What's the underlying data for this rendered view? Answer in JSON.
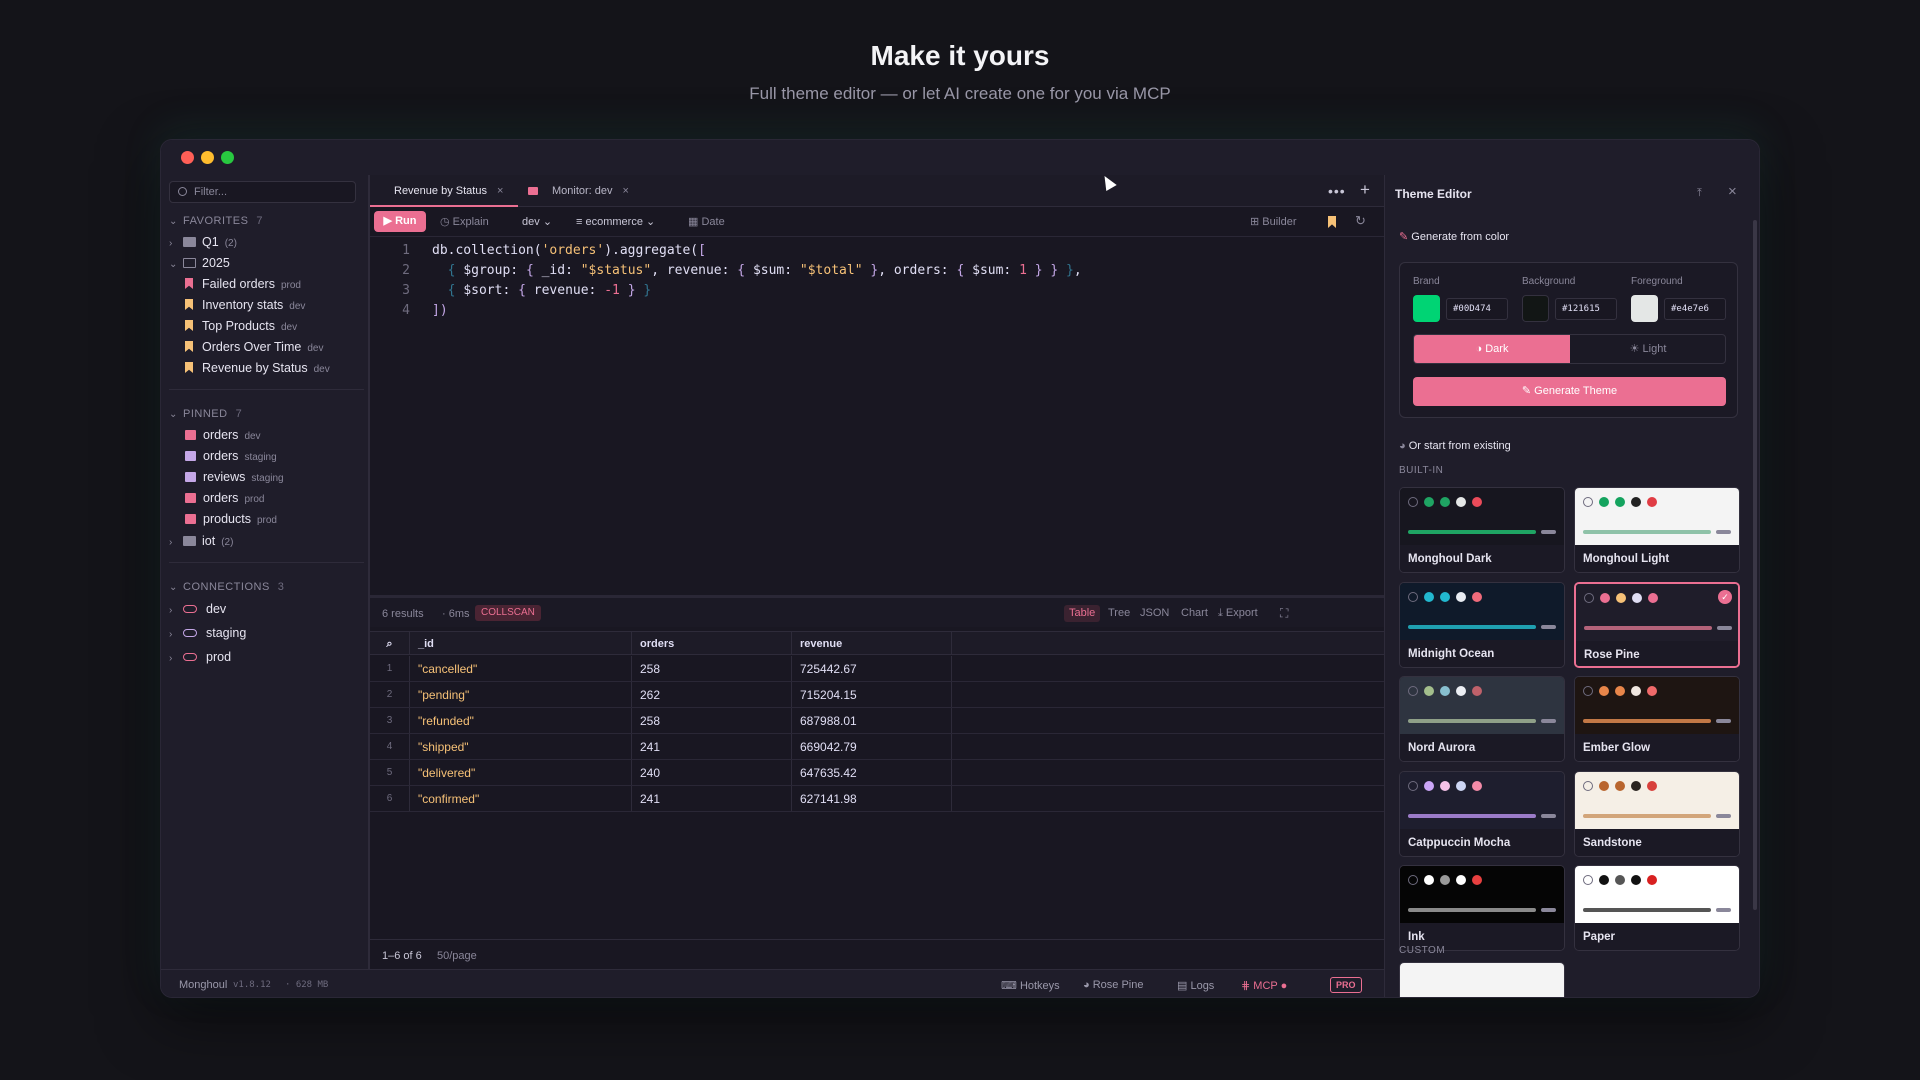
{
  "hero": {
    "title": "Make it yours",
    "subtitle": "Full theme editor — or let AI create one for you via MCP"
  },
  "window": {
    "traffic_lights": [
      "#ff5f57",
      "#febc2e",
      "#28c840"
    ]
  },
  "sidebar": {
    "filter_placeholder": "Filter...",
    "favorites": {
      "label": "FAVORITES",
      "count": "7",
      "folders": [
        {
          "name": "Q1",
          "count": "(2)"
        },
        {
          "name": "2025"
        }
      ],
      "items": [
        {
          "name": "Failed orders",
          "env": "prod",
          "color": "#eb6f92"
        },
        {
          "name": "Inventory stats",
          "env": "dev",
          "color": "#f6c177"
        },
        {
          "name": "Top Products",
          "env": "dev",
          "color": "#f6c177"
        },
        {
          "name": "Orders Over Time",
          "env": "dev",
          "color": "#f6c177"
        },
        {
          "name": "Revenue by Status",
          "env": "dev",
          "color": "#f6c177"
        }
      ]
    },
    "pinned": {
      "label": "PINNED",
      "count": "7",
      "items": [
        {
          "name": "orders",
          "env": "dev",
          "color": "#eb6f92"
        },
        {
          "name": "orders",
          "env": "staging",
          "color": "#c4a7e7"
        },
        {
          "name": "reviews",
          "env": "staging",
          "color": "#c4a7e7"
        },
        {
          "name": "orders",
          "env": "prod",
          "color": "#eb6f92"
        },
        {
          "name": "products",
          "env": "prod",
          "color": "#eb6f92"
        }
      ],
      "folder": {
        "name": "iot",
        "count": "(2)"
      }
    },
    "connections": {
      "label": "CONNECTIONS",
      "count": "3",
      "items": [
        {
          "name": "dev",
          "color": "#eb6f92"
        },
        {
          "name": "staging",
          "color": "#c4a7e7"
        },
        {
          "name": "prod",
          "color": "#eb6f92"
        }
      ]
    }
  },
  "tabs": [
    {
      "label": "Revenue by Status"
    },
    {
      "label": "Monitor: dev"
    }
  ],
  "toolbar": {
    "run": "Run",
    "explain": "Explain",
    "connection": "dev",
    "database": "ecommerce",
    "date": "Date",
    "builder": "Builder"
  },
  "code": {
    "lines": [
      "1",
      "2",
      "3",
      "4"
    ]
  },
  "results": {
    "count": "6 results",
    "time": "6ms",
    "badge": "COLLSCAN",
    "views": [
      "Table",
      "Tree",
      "JSON",
      "Chart"
    ],
    "export": "Export",
    "columns": [
      "_id",
      "orders",
      "revenue"
    ],
    "rows": [
      {
        "n": "1",
        "id": "\"cancelled\"",
        "orders": "258",
        "revenue": "725442.67"
      },
      {
        "n": "2",
        "id": "\"pending\"",
        "orders": "262",
        "revenue": "715204.15"
      },
      {
        "n": "3",
        "id": "\"refunded\"",
        "orders": "258",
        "revenue": "687988.01"
      },
      {
        "n": "4",
        "id": "\"shipped\"",
        "orders": "241",
        "revenue": "669042.79"
      },
      {
        "n": "5",
        "id": "\"delivered\"",
        "orders": "240",
        "revenue": "647635.42"
      },
      {
        "n": "6",
        "id": "\"confirmed\"",
        "orders": "241",
        "revenue": "627141.98"
      }
    ],
    "pager": "1–6 of 6",
    "per_page": "50/page"
  },
  "status": {
    "app": "Monghoul",
    "version": "v1.8.12",
    "memory": "· 628 MB",
    "hotkeys": "Hotkeys",
    "theme": "Rose Pine",
    "logs": "Logs",
    "mcp": "MCP",
    "pro": "PRO"
  },
  "theme_editor": {
    "title": "Theme Editor",
    "generate_label": "Generate from color",
    "brand_label": "Brand",
    "brand_hex": "#00D474",
    "brand_color": "#00D474",
    "bg_label": "Background",
    "bg_hex": "#121615",
    "bg_color": "#121615",
    "fg_label": "Foreground",
    "fg_hex": "#e4e7e6",
    "fg_color": "#e4e7e6",
    "dark": "Dark",
    "light": "Light",
    "generate_btn": "Generate Theme",
    "existing_label": "Or start from existing",
    "builtin_label": "BUILT-IN",
    "custom_label": "CUSTOM",
    "themes": [
      {
        "name": "Monghoul Dark",
        "bg": "#17161f",
        "bar": "#1fa463",
        "dots": [
          "#1fa463",
          "#1fa463",
          "#e4e7e6",
          "#eb4b5a"
        ]
      },
      {
        "name": "Monghoul Light",
        "bg": "#f4f4f4",
        "bar": "#8fc2a8",
        "dots": [
          "#14a35e",
          "#14a35e",
          "#222",
          "#e03c44"
        ]
      },
      {
        "name": "Midnight Ocean",
        "bg": "#0f1a2a",
        "bar": "#1fa0b0",
        "dots": [
          "#22b8cf",
          "#22b8cf",
          "#e8ecf2",
          "#f06b7b"
        ]
      },
      {
        "name": "Rose Pine",
        "bg": "#1f1d2a",
        "bar": "#b4637a",
        "dots": [
          "#eb6f92",
          "#f6c177",
          "#e0def4",
          "#eb6f92"
        ],
        "selected": true
      },
      {
        "name": "Nord Aurora",
        "bg": "#2e3440",
        "bar": "#8fa088",
        "dots": [
          "#a3be8c",
          "#88c0d0",
          "#eceff4",
          "#bf616a"
        ]
      },
      {
        "name": "Ember Glow",
        "bg": "#1e1512",
        "bar": "#c27846",
        "dots": [
          "#e8864a",
          "#e8864a",
          "#f0e6e0",
          "#f06a6a"
        ]
      },
      {
        "name": "Catppuccin Mocha",
        "bg": "#1e1e2e",
        "bar": "#9b7bc8",
        "dots": [
          "#cba6f7",
          "#f5c2e7",
          "#cdd6f4",
          "#f38ba8"
        ]
      },
      {
        "name": "Sandstone",
        "bg": "#f5efe6",
        "bar": "#d2a57a",
        "dots": [
          "#b9652e",
          "#b9652e",
          "#2a2420",
          "#d8403c"
        ]
      },
      {
        "name": "Ink",
        "bg": "#050505",
        "bar": "#8a8a8a",
        "dots": [
          "#ffffff",
          "#9a9a9a",
          "#ffffff",
          "#e84040"
        ]
      },
      {
        "name": "Paper",
        "bg": "#ffffff",
        "bar": "#555555",
        "dots": [
          "#111111",
          "#555555",
          "#111111",
          "#d82020"
        ]
      }
    ]
  }
}
